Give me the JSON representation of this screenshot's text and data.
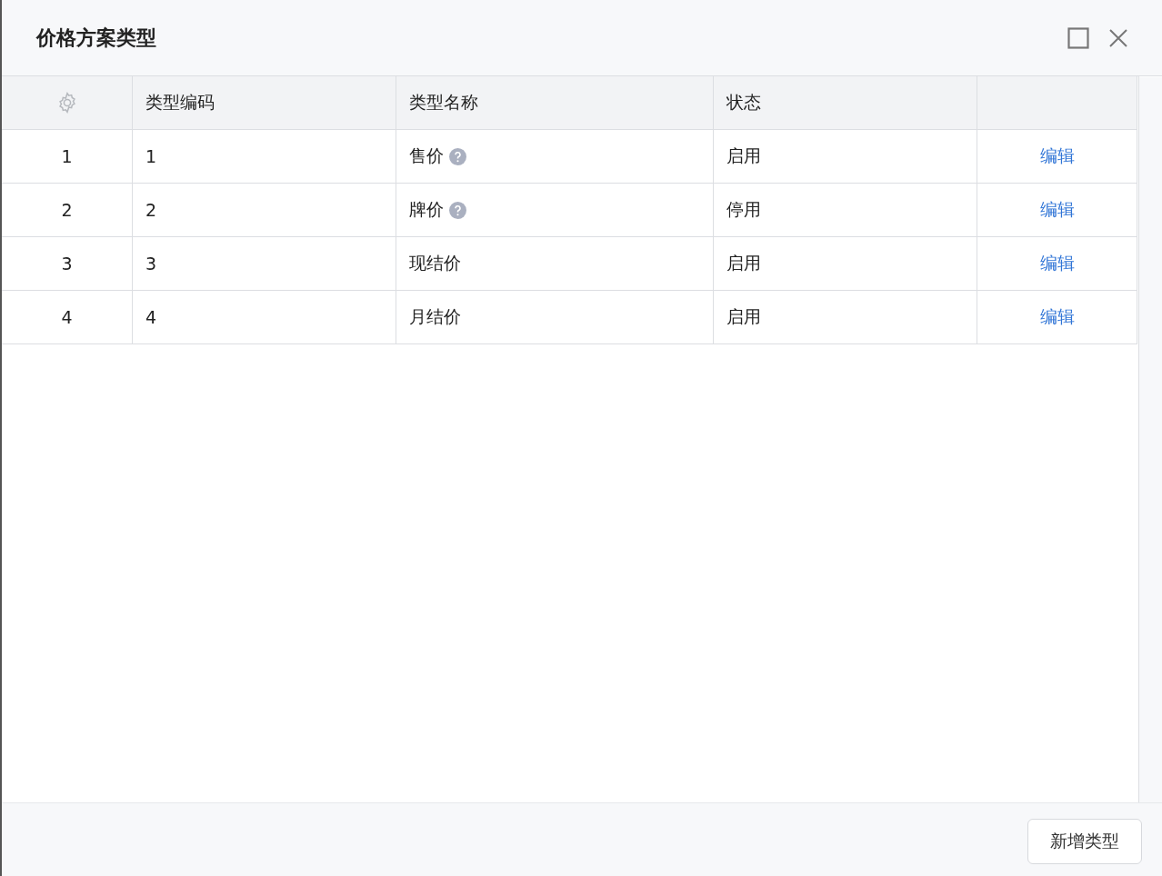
{
  "dialog": {
    "title": "价格方案类型"
  },
  "table": {
    "columns": [
      "类型编码",
      "类型名称",
      "状态"
    ],
    "rows": [
      {
        "index": "1",
        "code": "1",
        "name": "售价",
        "hint": true,
        "status": "启用",
        "action": "编辑"
      },
      {
        "index": "2",
        "code": "2",
        "name": "牌价",
        "hint": true,
        "status": "停用",
        "action": "编辑"
      },
      {
        "index": "3",
        "code": "3",
        "name": "现结价",
        "hint": false,
        "status": "启用",
        "action": "编辑"
      },
      {
        "index": "4",
        "code": "4",
        "name": "月结价",
        "hint": false,
        "status": "启用",
        "action": "编辑"
      }
    ]
  },
  "footer": {
    "buttons": [
      "新增类型"
    ]
  }
}
